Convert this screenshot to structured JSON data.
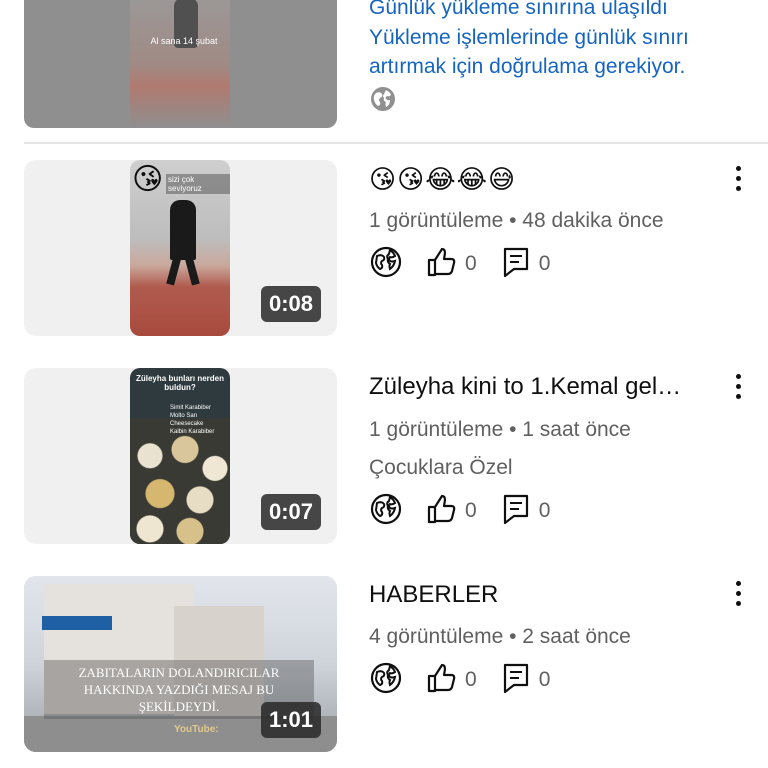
{
  "top_item": {
    "thumbnail_caption": "Al sana 14 şubat",
    "warning_lines": [
      "Günlük yükleme sınırına ulaşıldı",
      "Yükleme işlemlerinde günlük sınırı",
      "artırmak için doğrulama gerekiyor."
    ],
    "visibility_icon": "globe-icon"
  },
  "videos": [
    {
      "title": "😘😘😂😂😅",
      "meta": "1 görüntüleme • 48 dakika önce",
      "duration": "0:08",
      "thumbnail_caption": "sizi çok seviyoruz",
      "likes": "0",
      "comments": "0"
    },
    {
      "title": "Züleyha kini to 1.Kemal gel…",
      "meta": "1 görüntüleme • 1 saat önce",
      "playlist": "Çocuklara Özel",
      "duration": "0:07",
      "thumbnail_caption": "Züleyha bunları nerden buldun?",
      "thumbnail_list": "Simit Karabiber\nMolto Sarı\nCheesecake\nKalbin Karabiber",
      "likes": "0",
      "comments": "0"
    },
    {
      "title": "HABERLER",
      "meta": "4 görüntüleme • 2 saat önce",
      "duration": "1:01",
      "thumbnail_caption": "ZABITALARIN DOLANDIRICILAR HAKKINDA YAZDIĞI MESAJ BU ŞEKİLDEYDİ.",
      "thumbnail_watermark": "YouTube:",
      "likes": "0",
      "comments": "0"
    }
  ],
  "colors": {
    "warning_text": "#1565c0",
    "meta_text": "#606060",
    "duration_bg": "#282828"
  }
}
